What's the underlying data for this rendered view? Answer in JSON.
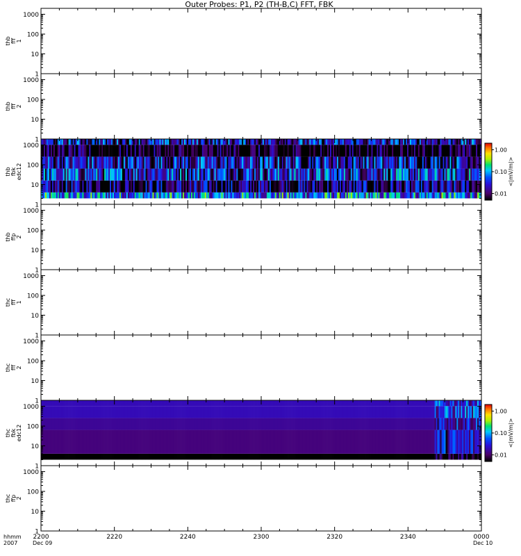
{
  "title": "Outer Probes: P1, P2 (TH-B,C) FFT, FBK",
  "chart_data": {
    "type": "heatmap",
    "title": "Outer Probes: P1, P2 (TH-B,C) FFT, FBK",
    "x_axis": {
      "scale": "time",
      "range": [
        "2200",
        "0000"
      ],
      "tick_labels": [
        "2200",
        "2220",
        "2240",
        "2300",
        "2320",
        "2340",
        "0000"
      ],
      "tick_minutes": [
        0,
        20,
        40,
        60,
        80,
        100,
        120
      ],
      "row_labels": [
        "hhmm",
        "2007"
      ],
      "date_start": "Dec 09",
      "date_end": "Dec 10"
    },
    "y_axis": {
      "scale": "log",
      "range": [
        1,
        2000
      ],
      "tick_labels": [
        "1",
        "10",
        "100",
        "1000"
      ],
      "tick_values": [
        1,
        10,
        100,
        1000
      ]
    },
    "colorbar": {
      "label": "<|mV/m|>",
      "tick_labels": [
        "1.00",
        "0.10",
        "0.01"
      ],
      "tick_values": [
        1.0,
        0.1,
        0.01
      ],
      "range": [
        0.005,
        2.0
      ]
    },
    "panels": [
      {
        "label": [
          "thb",
          "fff",
          "1"
        ],
        "has_data": false
      },
      {
        "label": [
          "thb",
          "fff",
          "2"
        ],
        "has_data": false
      },
      {
        "label": [
          "thb",
          "fbk",
          "edc12"
        ],
        "has_data": true,
        "bands": [
          {
            "freq_range": [
              2,
              4
            ],
            "level": 0.06,
            "variability": "high"
          },
          {
            "freq_range": [
              4,
              16
            ],
            "level": 0.01,
            "variability": "high"
          },
          {
            "freq_range": [
              16,
              64
            ],
            "level": 0.03,
            "variability": "high"
          },
          {
            "freq_range": [
              64,
              256
            ],
            "level": 0.02,
            "variability": "high"
          },
          {
            "freq_range": [
              256,
              1024
            ],
            "level": 0.004,
            "variability": "high"
          },
          {
            "freq_range": [
              1024,
              2048
            ],
            "level": 0.02,
            "variability": "high"
          }
        ]
      },
      {
        "label": [
          "thb",
          "ffp",
          "2"
        ],
        "has_data": false
      },
      {
        "label": [
          "thc",
          "fff",
          "1"
        ],
        "has_data": false
      },
      {
        "label": [
          "thc",
          "fff",
          "2"
        ],
        "has_data": false
      },
      {
        "label": [
          "thc",
          "fbk",
          "edc12"
        ],
        "has_data": true,
        "bands": [
          {
            "freq_range": [
              2,
              4
            ],
            "level": 0.003,
            "variability": "low"
          },
          {
            "freq_range": [
              4,
              64
            ],
            "level": 0.012,
            "variability": "low"
          },
          {
            "freq_range": [
              64,
              256
            ],
            "level": 0.015,
            "variability": "low"
          },
          {
            "freq_range": [
              256,
              1024
            ],
            "level": 0.02,
            "variability": "low"
          },
          {
            "freq_range": [
              1024,
              2048
            ],
            "level": 0.02,
            "variability": "low"
          }
        ],
        "active_after_minute": 107
      },
      {
        "label": [
          "thc",
          "ffp",
          "2"
        ],
        "has_data": false
      }
    ]
  }
}
